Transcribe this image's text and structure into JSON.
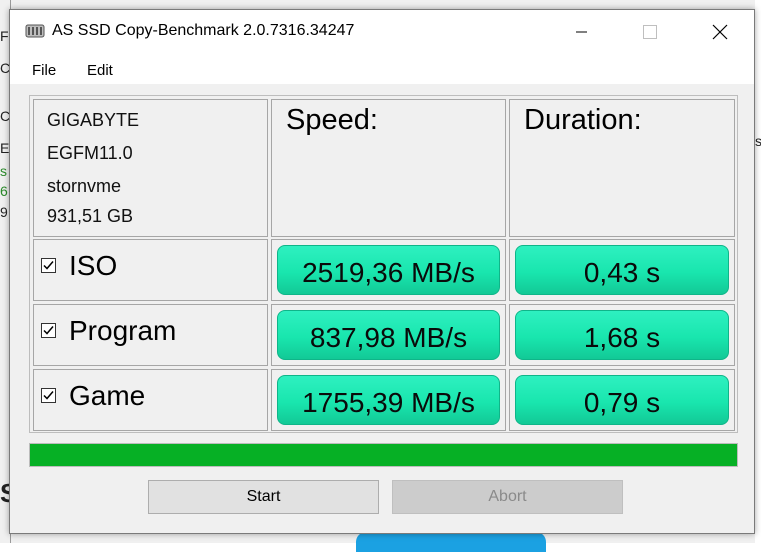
{
  "window": {
    "title": "AS SSD Copy-Benchmark 2.0.7316.34247",
    "icon": "hard-drive-icon"
  },
  "menu": {
    "items": [
      "File",
      "Edit"
    ]
  },
  "background_fragments": [
    "Fi",
    "C:",
    "C",
    "E",
    "s",
    "6",
    "9",
    "S"
  ],
  "right_fragment": "s",
  "drive_info": {
    "vendor": "GIGABYTE",
    "model": "EGFM11.0",
    "driver": "stornvme",
    "capacity": "931,51 GB"
  },
  "headers": {
    "speed": "Speed:",
    "duration": "Duration:"
  },
  "rows": [
    {
      "name": "ISO",
      "checked": true,
      "speed": "2519,36 MB/s",
      "duration": "0,43 s"
    },
    {
      "name": "Program",
      "checked": true,
      "speed": "837,98 MB/s",
      "duration": "1,68 s"
    },
    {
      "name": "Game",
      "checked": true,
      "speed": "1755,39 MB/s",
      "duration": "0,79 s"
    }
  ],
  "progress": {
    "fraction": 1.0,
    "color": "#06b025"
  },
  "buttons": {
    "start": "Start",
    "abort": "Abort",
    "abort_enabled": false
  },
  "colors": {
    "result_fill": "#19e6ae",
    "result_border": "#0fb589"
  }
}
